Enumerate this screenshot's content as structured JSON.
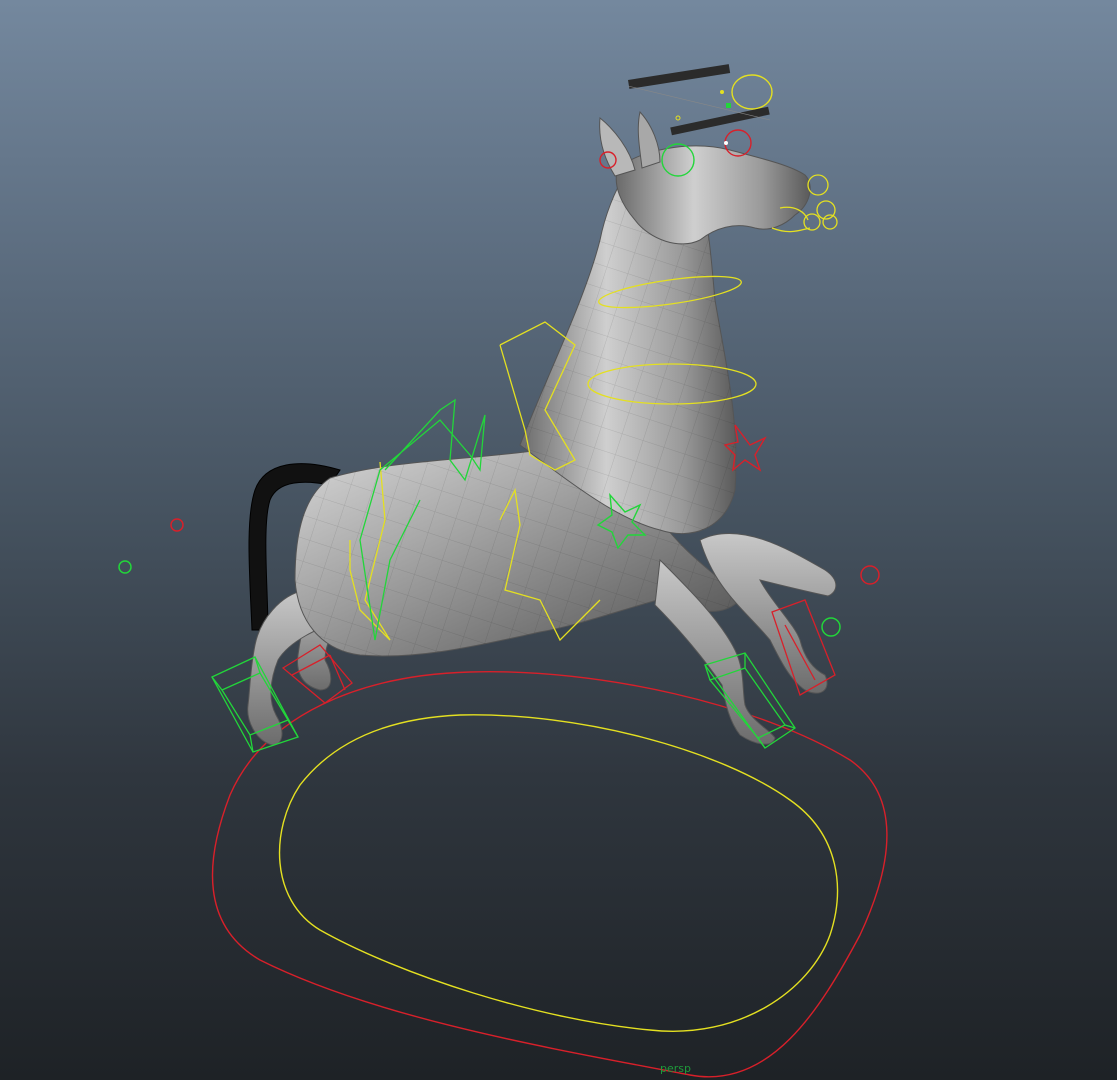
{
  "viewport": {
    "camera_label": "persp",
    "panel_color": "#1f9a3a"
  },
  "rig": {
    "control_colors": {
      "center": "#e4e021",
      "left": "#22d63a",
      "right": "#d8202a"
    }
  },
  "model": {
    "name": "horse-mesh",
    "surface": "grey-faceted"
  }
}
